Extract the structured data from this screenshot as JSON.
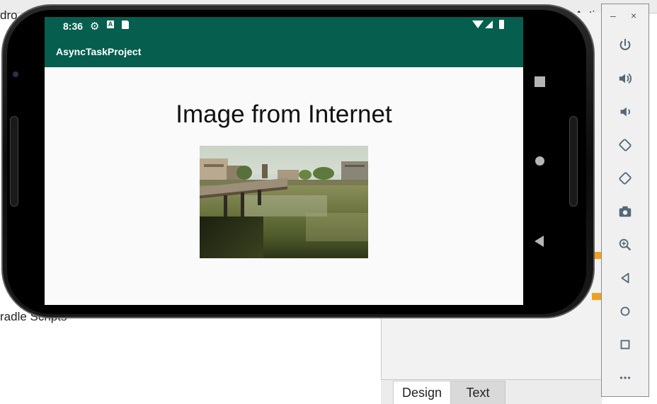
{
  "ide": {
    "top_left_fragment": "dro",
    "top_right_fragment": "Activ",
    "gradle_fragment": "radle Scripts",
    "tabs": [
      {
        "label": "Design",
        "active": true
      },
      {
        "label": "Text",
        "active": false
      }
    ]
  },
  "emulator": {
    "window_controls": {
      "minimize": "–",
      "close": "×"
    },
    "toolbar_icons": [
      "power-icon",
      "volume-up-icon",
      "volume-down-icon",
      "rotate-left-icon",
      "rotate-right-icon",
      "camera-icon",
      "zoom-icon",
      "back-icon",
      "home-icon",
      "overview-icon",
      "more-icon"
    ]
  },
  "device": {
    "status_bar": {
      "time": "8:36",
      "icons": [
        "gear-icon",
        "a-icon",
        "sd-card-icon",
        "wifi-icon",
        "signal-icon",
        "battery-icon"
      ]
    },
    "app_bar": {
      "title": "AsyncTaskProject"
    },
    "content": {
      "heading": "Image from Internet"
    },
    "nav_keys": [
      "overview-key",
      "home-key",
      "back-key"
    ]
  },
  "colors": {
    "primary": "#055e4e",
    "screen_background": "#fafafa",
    "toolbar_icon": "#536878"
  }
}
